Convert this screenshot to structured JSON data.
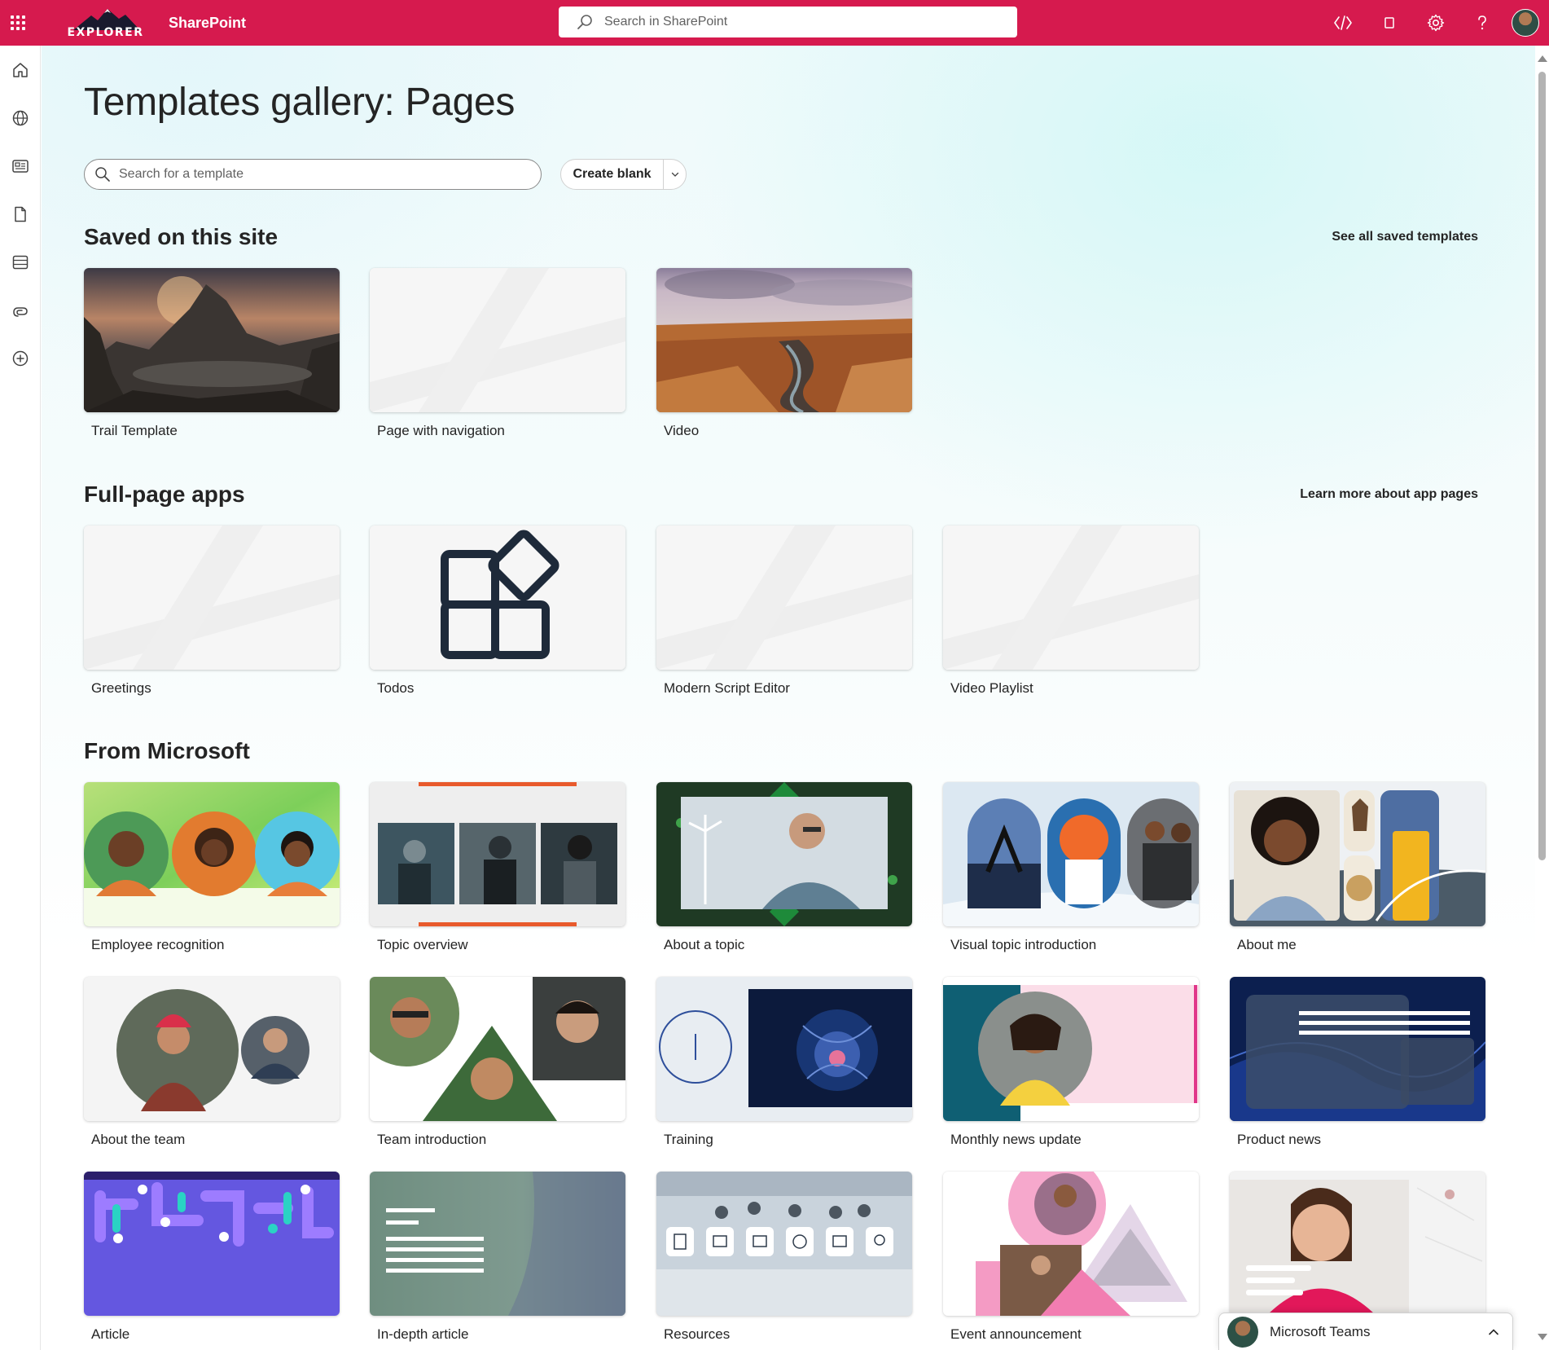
{
  "suite": {
    "logo_text": "EXPLORER",
    "app_name": "SharePoint",
    "search_placeholder": "Search in SharePoint",
    "icons": [
      "code-icon",
      "square-icon",
      "settings-gear-icon",
      "help-question-icon"
    ],
    "accent_color": "#d61a4e"
  },
  "appbar": {
    "items": [
      "home-icon",
      "globe-icon",
      "news-icon",
      "document-icon",
      "list-icon",
      "loop-icon",
      "add-circle-icon"
    ]
  },
  "page": {
    "title": "Templates gallery: Pages",
    "search_placeholder": "Search for a template",
    "create_blank_label": "Create blank"
  },
  "sections": {
    "saved": {
      "title": "Saved on this site",
      "link": "See all saved templates",
      "cards": [
        "Trail Template",
        "Page with navigation",
        "Video"
      ]
    },
    "apps": {
      "title": "Full-page apps",
      "link": "Learn more about app pages",
      "cards": [
        "Greetings",
        "Todos",
        "Modern Script Editor",
        "Video Playlist"
      ]
    },
    "microsoft": {
      "title": "From Microsoft",
      "cards": [
        "Employee recognition",
        "Topic overview",
        "About a topic",
        "Visual topic introduction",
        "About me",
        "About the team",
        "Team introduction",
        "Training",
        "Monthly news update",
        "Product news",
        "Article",
        "In-depth article",
        "Resources",
        "Event announcement"
      ]
    }
  },
  "teams": {
    "label": "Microsoft Teams"
  }
}
